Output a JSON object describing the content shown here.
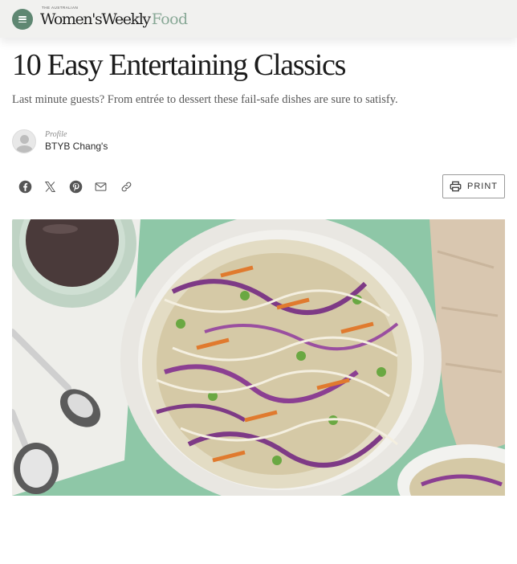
{
  "header": {
    "menu_icon": "hamburger-menu-icon",
    "logo": {
      "tagline": "THE AUSTRALIAN",
      "brand": "Women'sWeekly",
      "section": "Food"
    },
    "colors": {
      "bar": "#f1f1ef",
      "accent": "#5f8772",
      "food": "#88a896"
    }
  },
  "article": {
    "title": "10 Easy Entertaining Classics",
    "subtitle": "Last minute guests? From entrée to dessert these fail-safe dishes are sure to satisfy.",
    "author": {
      "label": "Profile",
      "name": "BTYB Chang's",
      "avatar_icon": "user-placeholder-icon"
    }
  },
  "share": {
    "icons": [
      "facebook-icon",
      "x-twitter-icon",
      "pinterest-icon",
      "email-icon",
      "link-icon"
    ]
  },
  "print": {
    "label": "PRINT",
    "icon": "printer-icon"
  },
  "hero_image": {
    "subject": "noodle-salad-photo"
  }
}
